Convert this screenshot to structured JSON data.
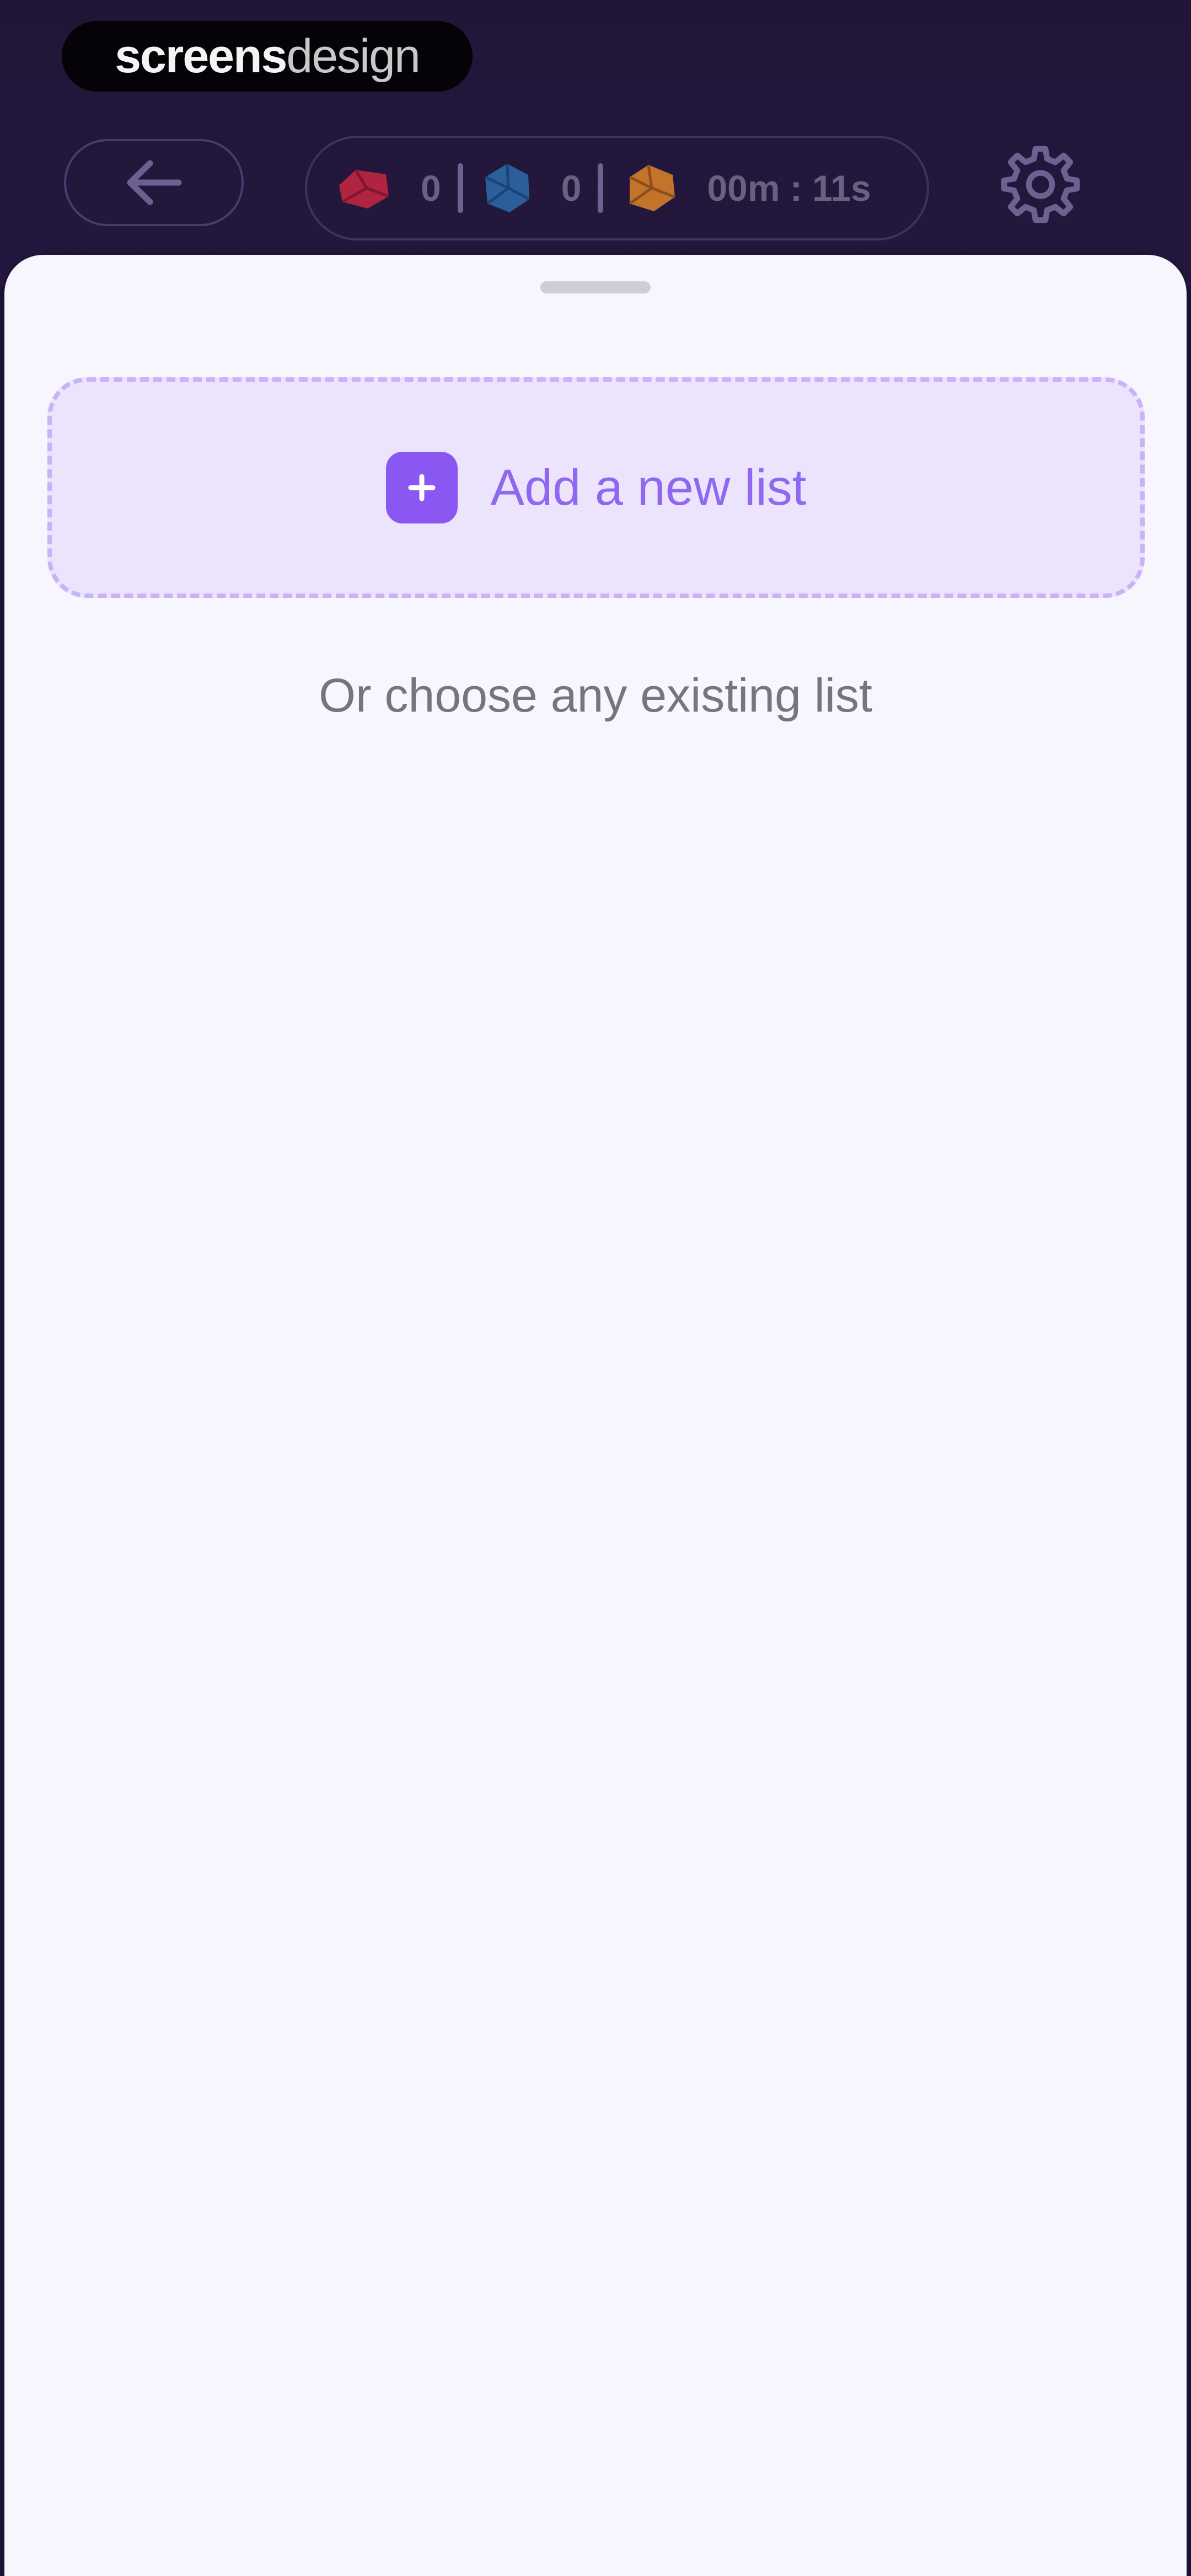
{
  "watermark": {
    "part1": "screens",
    "part2": "design"
  },
  "header": {
    "back_icon": "arrow-left-icon",
    "stats": [
      {
        "icon": "red-gem-icon",
        "value": "0",
        "color": "#c62a4a"
      },
      {
        "icon": "blue-gem-icon",
        "value": "0",
        "color": "#2b6fb8"
      },
      {
        "icon": "orange-gem-icon",
        "value": "00m : 11s",
        "color": "#d9822b"
      }
    ],
    "settings_icon": "gear-icon"
  },
  "sheet": {
    "add_list_label": "Add a new list",
    "add_icon": "plus-icon",
    "choose_text": "Or choose any existing list"
  },
  "colors": {
    "accent": "#8a57f2",
    "header_bg": "#211638",
    "sheet_bg": "#f7f5fe"
  }
}
